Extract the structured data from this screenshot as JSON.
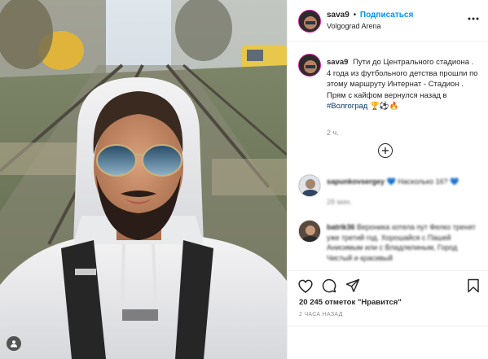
{
  "post": {
    "username": "sava9",
    "follow_label": "Подписаться",
    "location": "Volgograd Arena",
    "caption_text": "Пути до Центрального стадиона . 4 года из футбольного детства прошли по этому маршруту Интернат - Стадион .",
    "caption_line2": "Прям с кайфом вернулся назад в",
    "hashtag": "#Волгоград",
    "emoji": "🏆⚽🔥",
    "caption_time": "2 ч.",
    "likes_count": "20 245",
    "likes_suffix": "отметок \"Нравится\"",
    "post_date": "2 ЧАСА НАЗАД"
  },
  "comments": [
    {
      "username": "sapunkovsergey",
      "text": "Насколько 16?",
      "time": "28 мин."
    },
    {
      "username": "batrik36",
      "text": "Вероника хотела пут Фелко тренят уже третий год. Хорошайся с Пашей Анисимым или с Владлелиным, Город Чистый и красивый",
      "time": ""
    }
  ],
  "colors": {
    "follow_blue": "#0095f6",
    "hashtag": "#00376b",
    "muted": "#8e8e8e",
    "border": "#efefef",
    "story_ring": "#d6249f"
  },
  "icons": [
    "more-icon",
    "plus-circle-icon",
    "heart-icon",
    "comment-icon",
    "share-icon",
    "bookmark-icon",
    "user-tag-icon"
  ]
}
